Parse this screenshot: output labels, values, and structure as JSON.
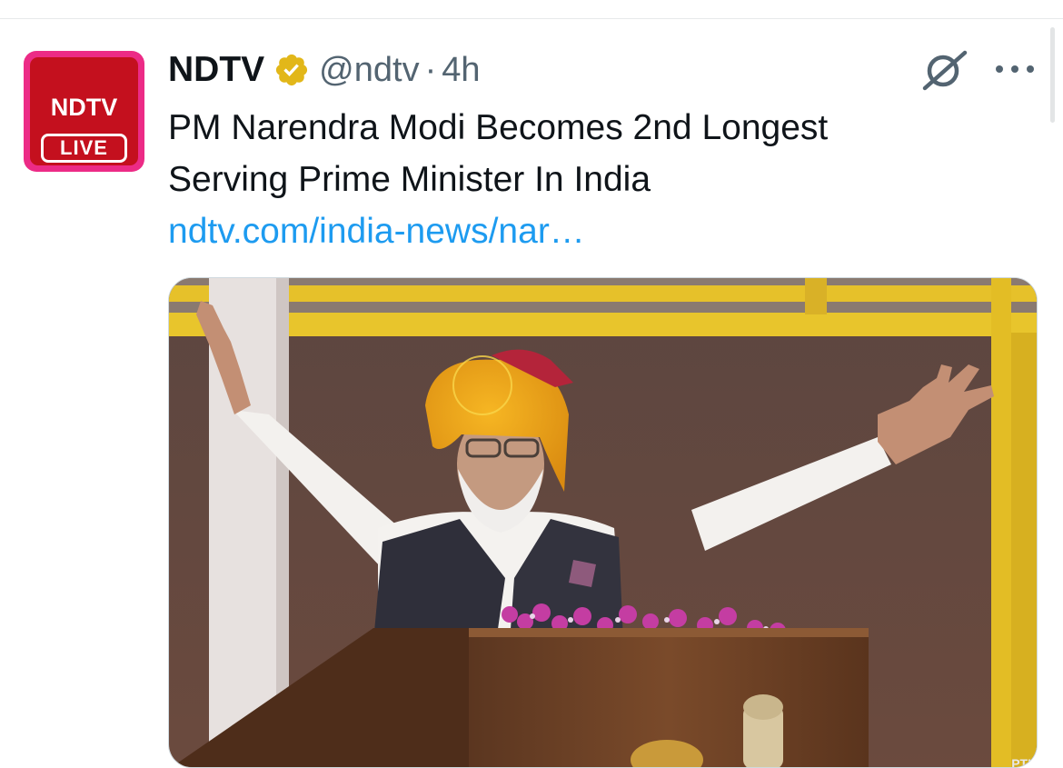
{
  "tweet": {
    "author": {
      "display_name": "NDTV",
      "handle": "@ndtv",
      "verified_icon": "verified-gold-badge-icon",
      "avatar": {
        "wordmark": "NDTV",
        "badge": "LIVE",
        "colors": {
          "frame": "#ec2b86",
          "background": "#c4101e",
          "text": "#ffffff"
        }
      }
    },
    "separator": "·",
    "timestamp": "4h",
    "text_lines": [
      "PM Narendra Modi Becomes 2nd Longest",
      "Serving Prime Minister In India"
    ],
    "link": "ndtv.com/india-news/nar…",
    "actions": {
      "grok_icon": "grok-icon",
      "more_icon": "more-horizontal-icon"
    },
    "media": {
      "type": "photo",
      "credit": "PTI"
    }
  },
  "colors": {
    "primary_text": "#0f1419",
    "secondary_text": "#536471",
    "link": "#1d9bf0",
    "verified_gold": "#e2b719"
  }
}
